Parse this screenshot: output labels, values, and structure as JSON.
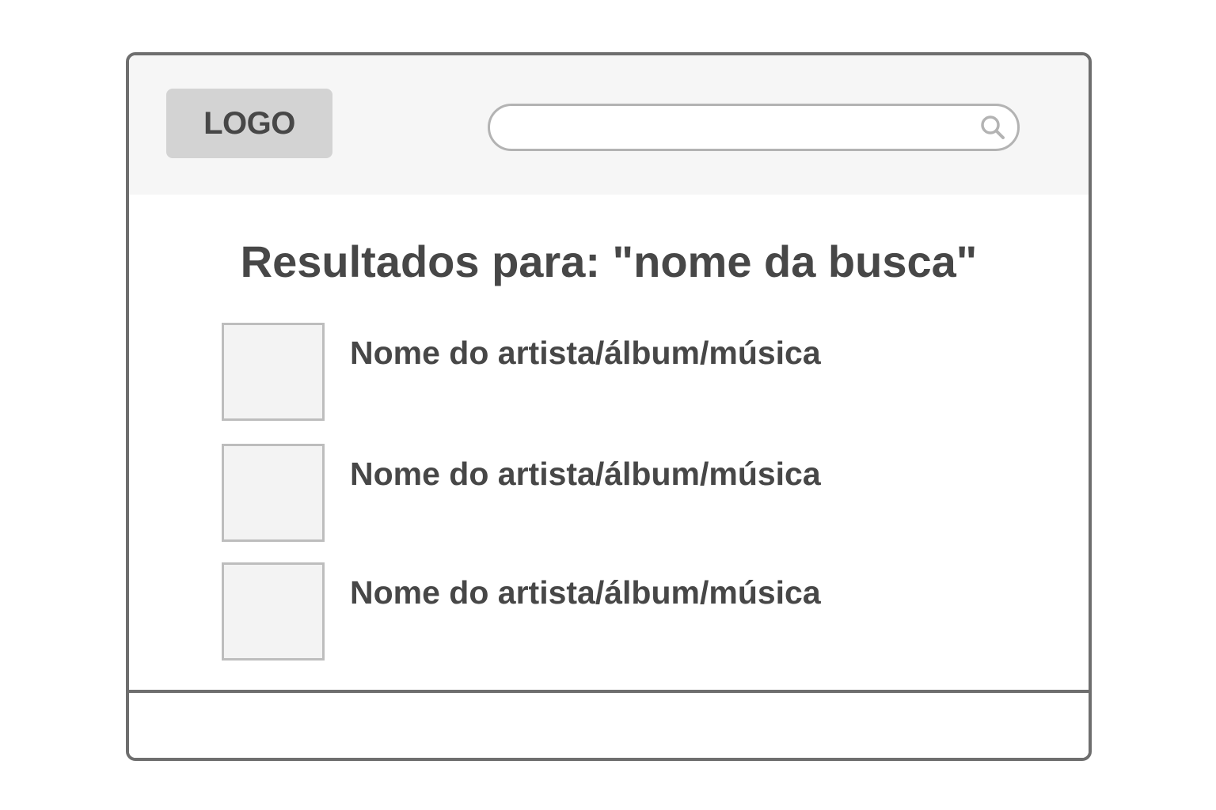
{
  "header": {
    "logo_text": "LOGO",
    "search": {
      "value": "",
      "placeholder": "",
      "icon": "search-icon"
    }
  },
  "main": {
    "title": "Resultados para: \"nome da busca\"",
    "results": [
      {
        "label": "Nome do artista/álbum/música"
      },
      {
        "label": "Nome do artista/álbum/música"
      },
      {
        "label": "Nome do artista/álbum/música"
      }
    ]
  },
  "colors": {
    "border": "#6e6e6e",
    "header_bg": "#f6f6f6",
    "logo_bg": "#d3d3d3",
    "text": "#474747",
    "thumb_bg": "#f3f3f3",
    "thumb_border": "#bdbdbd"
  }
}
